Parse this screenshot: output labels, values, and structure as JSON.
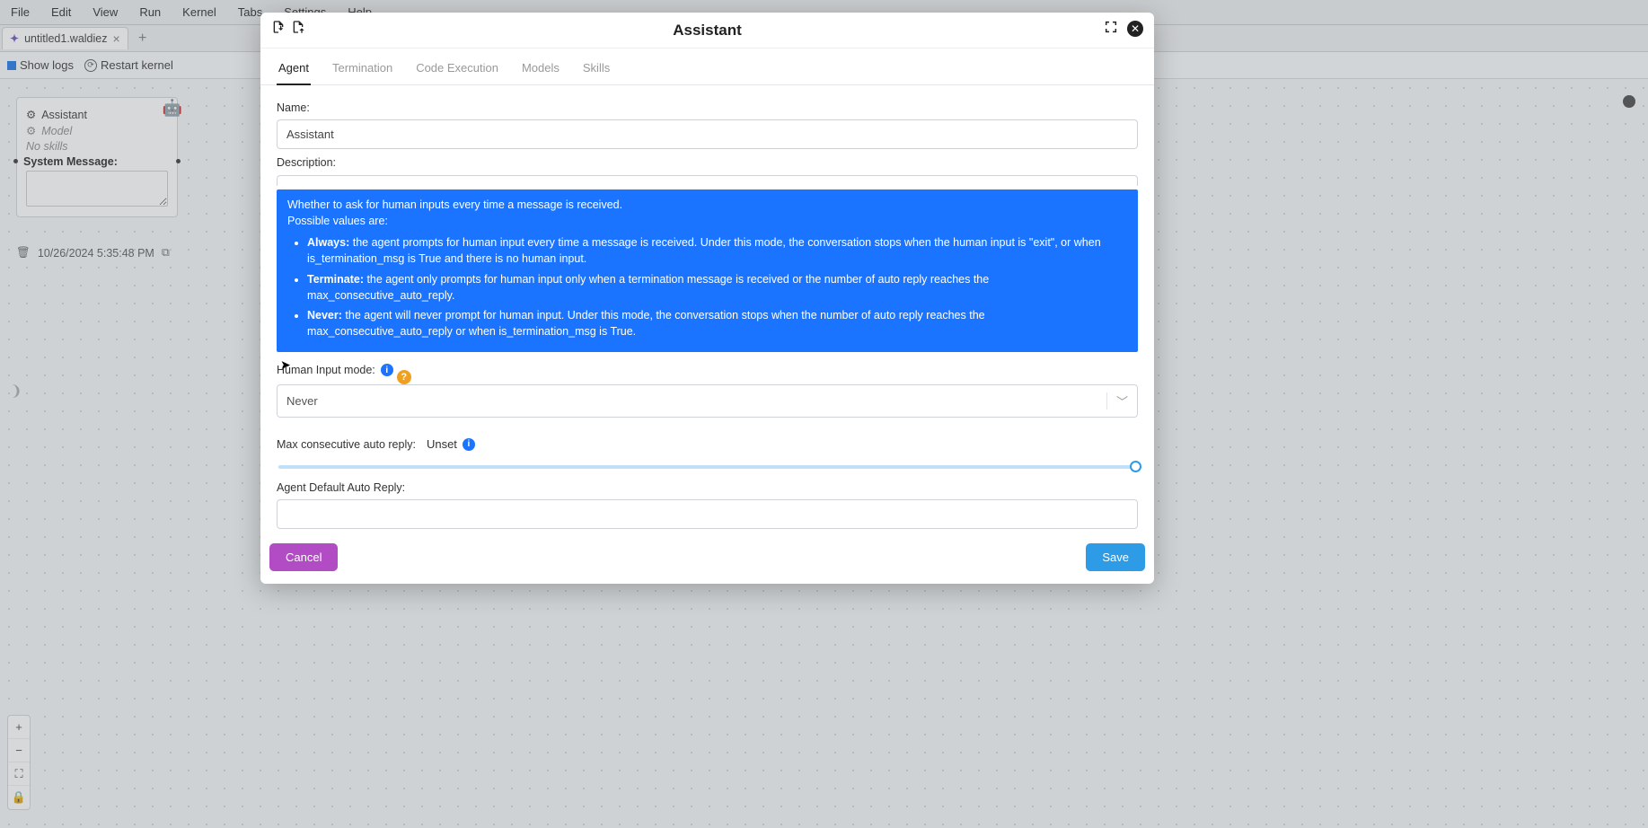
{
  "menu": {
    "items": [
      "File",
      "Edit",
      "View",
      "Run",
      "Kernel",
      "Tabs",
      "Settings",
      "Help"
    ]
  },
  "tabstrip": {
    "active_tab": "untitled1.waldiez"
  },
  "subbar": {
    "show_logs": "Show logs",
    "restart_kernel": "Restart kernel"
  },
  "agent_card": {
    "title": "Assistant",
    "model_label": "Model",
    "no_skills": "No skills",
    "system_message_label": "System Message:",
    "system_message_value": "",
    "timestamp": "10/26/2024 5:35:48 PM"
  },
  "modal": {
    "title": "Assistant",
    "tabs": [
      "Agent",
      "Termination",
      "Code Execution",
      "Models",
      "Skills"
    ],
    "active_tab_index": 0,
    "name_label": "Name:",
    "name_value": "Assistant",
    "description_label": "Description:",
    "description_value": "",
    "tooltip": {
      "intro1": "Whether to ask for human inputs every time a message is received.",
      "intro2": "Possible values are:",
      "opts": [
        {
          "key": "Always:",
          "text": " the agent prompts for human input every time a message is received. Under this mode, the conversation stops when the human input is \"exit\", or when is_termination_msg is True and there is no human input."
        },
        {
          "key": "Terminate:",
          "text": " the agent only prompts for human input only when a termination message is received or the number of auto reply reaches the max_consecutive_auto_reply."
        },
        {
          "key": "Never:",
          "text": " the agent will never prompt for human input. Under this mode, the conversation stops when the number of auto reply reaches the max_consecutive_auto_reply or when is_termination_msg is True."
        }
      ]
    },
    "human_input_label": "Human Input mode:",
    "human_input_value": "Never",
    "max_auto_label": "Max consecutive auto reply:",
    "max_auto_value": "Unset",
    "default_reply_label": "Agent Default Auto Reply:",
    "default_reply_value": "",
    "cancel": "Cancel",
    "save": "Save"
  }
}
